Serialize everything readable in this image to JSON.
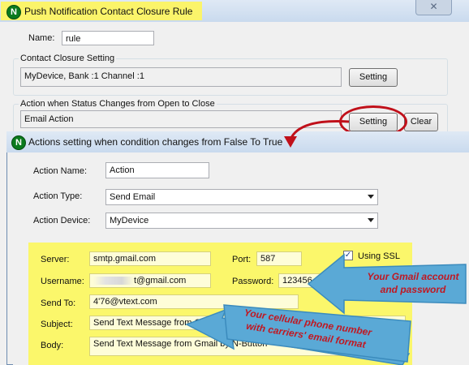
{
  "main_window": {
    "title": "Push Notification Contact Closure Rule",
    "close_label": "✕",
    "name_label": "Name:",
    "name_value": "rule",
    "contact_group_title": "Contact Closure Setting",
    "contact_value": "MyDevice, Bank :1 Channel :1",
    "contact_setting_button": "Setting",
    "action_group_title": "Action when Status Changes from Open to Close",
    "action_value": "Email Action",
    "action_setting_button": "Setting",
    "clear_button": "Clear"
  },
  "dialog": {
    "title": "Actions setting when condition changes from False To True",
    "action_name_label": "Action Name:",
    "action_name_value": "Action",
    "action_type_label": "Action Type:",
    "action_type_value": "Send Email",
    "action_device_label": "Action Device:",
    "action_device_value": "MyDevice"
  },
  "email": {
    "server_label": "Server:",
    "server_value": "smtp.gmail.com",
    "port_label": "Port:",
    "port_value": "587",
    "ssl_label": "Using SSL",
    "ssl_checked": true,
    "username_label": "Username:",
    "username_value": "t@gmail.com",
    "password_label": "Password:",
    "password_value": "123456",
    "sendto_label": "Send To:",
    "sendto_value": "4'76@vtext.com",
    "subject_label": "Subject:",
    "subject_value": "Send Text Message from Gma",
    "body_label": "Body:",
    "body_value": "Send Text Message from Gmail by N-Button"
  },
  "callouts": {
    "gmail_line1": "Your Gmail account",
    "gmail_line2": "and  password",
    "phone_line1": "Your cellular phone number",
    "phone_line2": "with carriers' email format"
  },
  "colors": {
    "highlight_yellow": "#fbf76b",
    "callout_red": "#c01822",
    "arrow_blue": "#5aa9d6"
  },
  "icons": {
    "app": "n-button-logo-icon",
    "close": "close-icon",
    "dropdown": "chevron-down-icon"
  }
}
